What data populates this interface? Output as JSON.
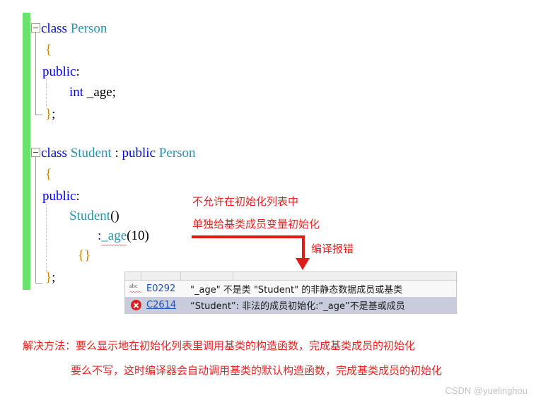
{
  "editor": {
    "change_bar_color": "#6ce16c",
    "keyword_color": "#0000ff",
    "type_color": "#2b91af",
    "code_blocks": [
      {
        "name": "person-class",
        "lines": [
          {
            "indent": 0,
            "tokens": [
              {
                "t": "class",
                "k": "kw"
              },
              {
                "t": " ",
                "k": "plain"
              },
              {
                "t": "Person",
                "k": "type"
              }
            ]
          },
          {
            "indent": 1,
            "tokens": [
              {
                "t": "{",
                "k": "brace"
              }
            ]
          },
          {
            "indent": 0,
            "tokens": [
              {
                "t": "public",
                "k": "kw"
              },
              {
                "t": ":",
                "k": "punct"
              }
            ]
          },
          {
            "indent": 2,
            "tokens": [
              {
                "t": "int",
                "k": "kw"
              },
              {
                "t": " _age;",
                "k": "punct"
              }
            ]
          },
          {
            "indent": 1,
            "tokens": [
              {
                "t": "}",
                "k": "brace"
              },
              {
                "t": ";",
                "k": "punct"
              }
            ]
          }
        ]
      },
      {
        "name": "student-class",
        "lines": [
          {
            "indent": 0,
            "tokens": [
              {
                "t": "class",
                "k": "kw"
              },
              {
                "t": " ",
                "k": "plain"
              },
              {
                "t": "Student",
                "k": "type"
              },
              {
                "t": " : ",
                "k": "punct"
              },
              {
                "t": "public",
                "k": "kw"
              },
              {
                "t": " ",
                "k": "plain"
              },
              {
                "t": "Person",
                "k": "type"
              }
            ]
          },
          {
            "indent": 1,
            "tokens": [
              {
                "t": "{",
                "k": "brace"
              }
            ]
          },
          {
            "indent": 0,
            "tokens": [
              {
                "t": "public",
                "k": "kw"
              },
              {
                "t": ":",
                "k": "punct"
              }
            ]
          },
          {
            "indent": 2,
            "tokens": [
              {
                "t": "Student",
                "k": "type"
              },
              {
                "t": "()",
                "k": "punct"
              }
            ]
          },
          {
            "indent": 3,
            "tokens": [
              {
                "t": ":",
                "k": "kw"
              },
              {
                "t": "_age",
                "k": "squiggle"
              },
              {
                "t": "(10)",
                "k": "punct"
              }
            ]
          },
          {
            "indent": 2,
            "tokens": [
              {
                "t": "{}",
                "k": "brace"
              }
            ]
          },
          {
            "indent": 1,
            "tokens": [
              {
                "t": "}",
                "k": "brace"
              },
              {
                "t": ";",
                "k": "punct"
              }
            ]
          }
        ]
      }
    ],
    "code_text": {
      "l1": "class Person",
      "l2": "{",
      "l3": "public:",
      "l4": "int _age;",
      "l5": "};",
      "l6": "class Student : public Person",
      "l7": "{",
      "l8": "public:",
      "l9": "Student()",
      "l10": ":_age(10)",
      "l11": "{}",
      "l12": "};"
    }
  },
  "annotations": {
    "color": "#ee2222",
    "note_line1": "不允许在初始化列表中",
    "note_line2": "单独给基类成员变量初始化",
    "arrow_label": "编译报错"
  },
  "error_panel": {
    "rows": [
      {
        "icon": "abc-squiggle-icon",
        "code": "E0292",
        "message": "\"_age\" 不是类 \"Student\" 的非静态数据成员或基类",
        "selected": false
      },
      {
        "icon": "error-x-icon",
        "code": "C2614",
        "message": "“Student”: 非法的成员初始化:“_age”不是基或成员",
        "selected": true
      }
    ]
  },
  "solution": {
    "line1": "解决方法：要么显示地在初始化列表里调用基类的构造函数，完成基类成员的初始化",
    "line2": "要么不写，这时编译器会自动调用基类的默认构造函数，完成基类成员的初始化"
  },
  "watermark": {
    "text": "CSDN @yuelinghou"
  }
}
